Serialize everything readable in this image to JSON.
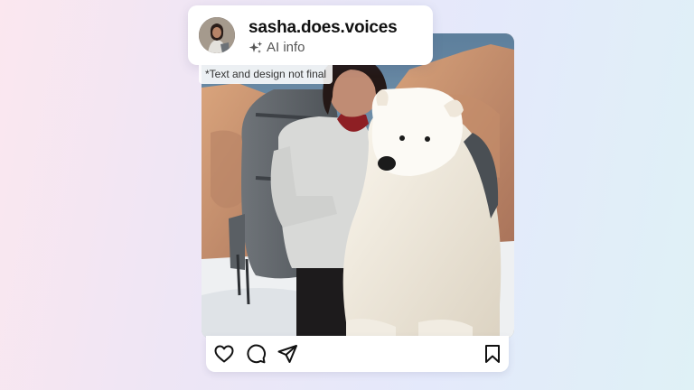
{
  "post": {
    "username": "sasha.does.voices",
    "ai_label": "AI info",
    "disclaimer": "*Text and design not final"
  },
  "icons": {
    "ai": "sparkle-icon",
    "like": "heart-icon",
    "comment": "comment-icon",
    "share": "send-icon",
    "save": "bookmark-icon"
  },
  "colors": {
    "card_background": "#ffffff",
    "username_text": "#111111",
    "secondary_text": "#555555"
  }
}
